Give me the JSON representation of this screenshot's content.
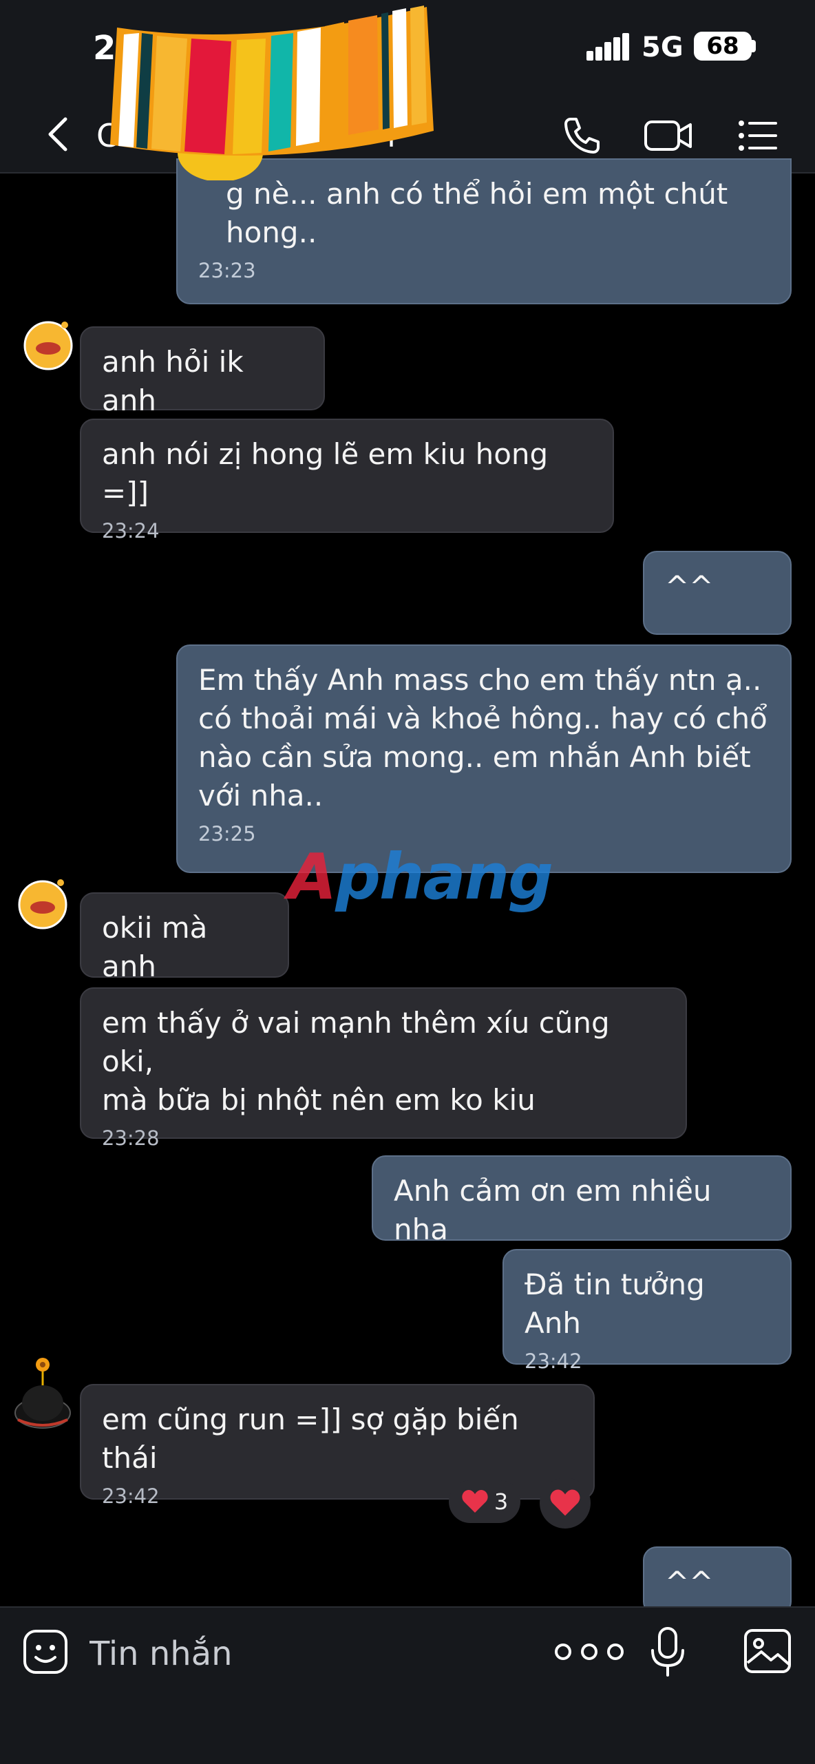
{
  "status_bar": {
    "time": "2",
    "network": "5G",
    "battery": "68"
  },
  "header": {
    "title": "C",
    "title_suffix": "i"
  },
  "messages": [
    {
      "side": "out",
      "text": "g nè... anh có thể hỏi em một chút\nhong..",
      "time": "23:23"
    },
    {
      "side": "in",
      "text": "anh hỏi ik anh",
      "time": ""
    },
    {
      "side": "in",
      "text": "anh nói zị hong lẽ em kiu hong =]]",
      "time": "23:24"
    },
    {
      "side": "out",
      "text": "^^",
      "time": ""
    },
    {
      "side": "out",
      "text": "Em thấy Anh mass cho em thấy ntn ạ..\ncó thoải mái và khoẻ hông.. hay có chổ\nnào cần sửa mong.. em nhắn Anh biết\nvới nha..",
      "time": "23:25"
    },
    {
      "side": "in",
      "text": "okii mà anh",
      "time": ""
    },
    {
      "side": "in",
      "text": "em thấy ở vai mạnh thêm xíu cũng oki,\nmà bữa bị nhột nên em ko kiu",
      "time": "23:28"
    },
    {
      "side": "out",
      "text": "Anh cảm ơn em nhiều nha",
      "time": ""
    },
    {
      "side": "out",
      "text": "Đã tin tưởng Anh",
      "time": "23:42"
    },
    {
      "side": "in",
      "text": "em cũng run =]] sợ gặp biến thái",
      "time": "23:42"
    },
    {
      "side": "out",
      "text": "^^",
      "time": ""
    }
  ],
  "reactions": {
    "count": "3",
    "icon": "heart-icon"
  },
  "watermark": {
    "part1": "A",
    "part2": "phang"
  },
  "input_bar": {
    "placeholder": "Tin nhắn"
  },
  "colors": {
    "background": "#000000",
    "bar": "#16181c",
    "incoming_bubble": "#2b2b30",
    "outgoing_bubble": "#46586e",
    "heart": "#e8334a"
  }
}
